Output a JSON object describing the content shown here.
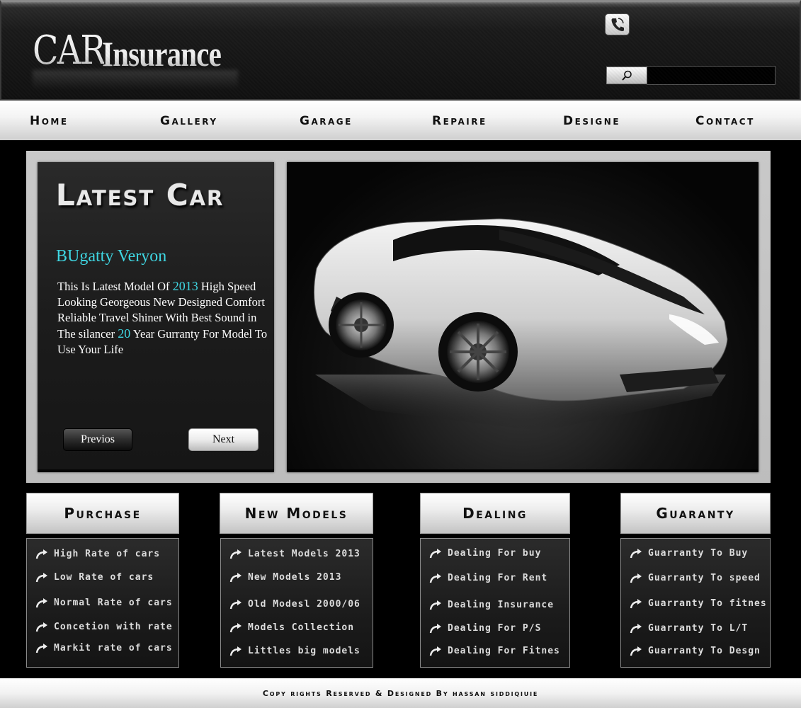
{
  "header": {
    "logo_car": "CAR",
    "logo_insurance": "Insurance",
    "search_placeholder": ""
  },
  "nav": {
    "items": [
      "Home",
      "Gallery",
      "GARAGE",
      "Repaire",
      "Designe",
      "Contact"
    ]
  },
  "feature": {
    "title": "Latest Car",
    "car_name": "BUgatty Veryon",
    "desc": {
      "part1": "This Is Latest Model Of ",
      "year": "2013",
      "part2": " High Speed Looking Georgeous New Designed Comfort Reliable Travel Shiner With Best Sound in The silancer ",
      "years": "20",
      "part3": " Year Gurranty For Model To Use Your Life"
    },
    "prev_label": "Previos",
    "next_label": "Next"
  },
  "categories": [
    {
      "title": "Purchase",
      "links": [
        "High Rate of cars",
        "Low Rate of cars",
        "Normal Rate of cars",
        "Concetion with rate",
        "Markit rate of cars"
      ]
    },
    {
      "title": "New Models",
      "links": [
        "Latest Models 2013",
        "New Models 2013",
        "Old Modesl 2000/06",
        "Models Collection",
        "Littles big models"
      ]
    },
    {
      "title": "Dealing",
      "links": [
        "Dealing For buy",
        "Dealing For Rent",
        "Dealing Insurance",
        "Dealing For P/S",
        "Dealing For Fitnes"
      ]
    },
    {
      "title": "Guaranty",
      "links": [
        "Guarranty To Buy",
        "Guarranty To speed",
        "Guarranty To fitnes",
        "Guarranty To L/T",
        "Guarranty To Desgn"
      ]
    }
  ],
  "footer": {
    "text": "Copy rights Reserved & Designed By hassan siddiqiuie"
  },
  "colors": {
    "accent": "#3fd6e2",
    "background": "#000000"
  },
  "icons": {
    "phone": "phone-icon",
    "search": "search-icon",
    "link_arrow": "curved-arrow-icon"
  }
}
